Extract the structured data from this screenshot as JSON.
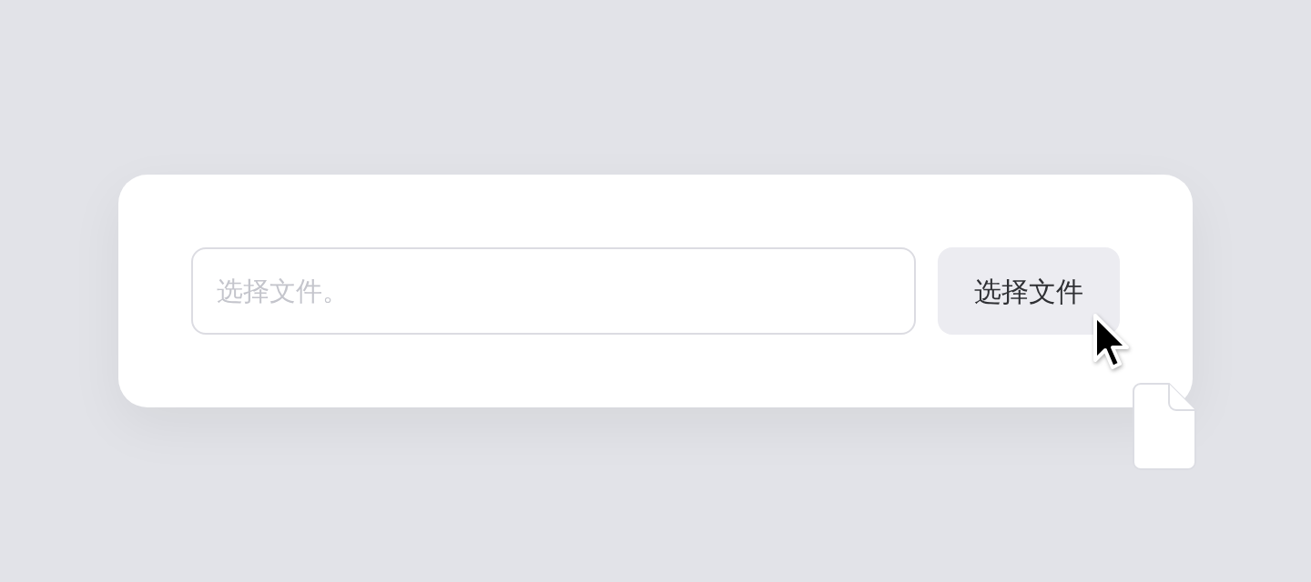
{
  "file_input": {
    "placeholder": "选择文件。"
  },
  "choose_button": {
    "label": "选择文件"
  }
}
